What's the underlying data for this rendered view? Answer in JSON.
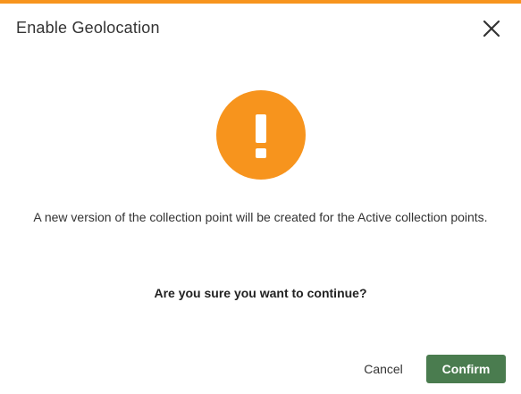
{
  "dialog": {
    "title": "Enable Geolocation",
    "message": "A new version of the collection point will be created for the Active collection points.",
    "question": "Are you sure you want to continue?",
    "icon": "warning-exclamation-icon",
    "close_icon": "close-icon"
  },
  "buttons": {
    "cancel_label": "Cancel",
    "confirm_label": "Confirm"
  },
  "colors": {
    "accent": "#f7941d",
    "confirm": "#4a7c4f",
    "text": "#333333"
  }
}
